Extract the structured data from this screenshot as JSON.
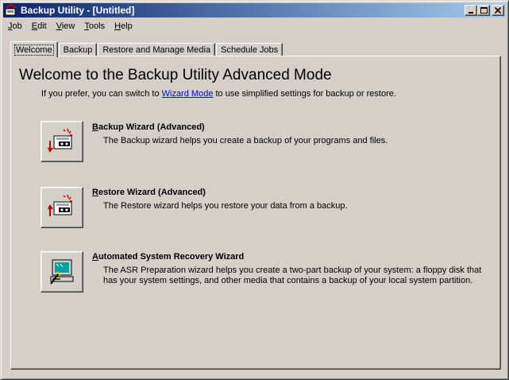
{
  "window": {
    "title": "Backup Utility - [Untitled]"
  },
  "menu": {
    "items": [
      {
        "key": "J",
        "rest": "ob"
      },
      {
        "key": "E",
        "rest": "dit"
      },
      {
        "key": "V",
        "rest": "iew"
      },
      {
        "key": "T",
        "rest": "ools"
      },
      {
        "key": "H",
        "rest": "elp"
      }
    ]
  },
  "tabs": [
    {
      "label": "Welcome"
    },
    {
      "label": "Backup"
    },
    {
      "label": "Restore and Manage Media"
    },
    {
      "label": "Schedule Jobs"
    }
  ],
  "welcome": {
    "title": "Welcome to the Backup Utility Advanced Mode",
    "intro_before": "If you prefer, you can switch to ",
    "intro_link": "Wizard Mode",
    "intro_after": " to use simplified settings for backup or restore."
  },
  "wizards": [
    {
      "key": "B",
      "rest": "ackup Wizard (Advanced)",
      "desc": "The Backup wizard helps you create a backup of your programs and files."
    },
    {
      "key": "R",
      "rest": "estore Wizard (Advanced)",
      "desc": "The Restore wizard helps you restore your data from a backup."
    },
    {
      "key": "A",
      "rest": "utomated System Recovery Wizard",
      "desc": "The ASR Preparation wizard helps you create a two-part backup of your system: a floppy disk that has your system settings, and other media that contains a backup of your local system partition."
    }
  ]
}
